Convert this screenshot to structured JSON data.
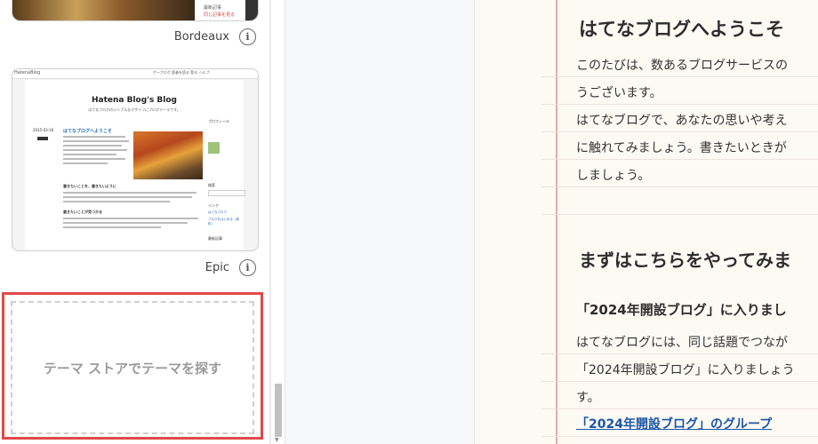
{
  "themes": {
    "top_partial": {
      "side_text_1": "最新記事",
      "side_text_2": "同じ記事を見る"
    },
    "bordeaux": {
      "label": "Bordeaux"
    },
    "epic": {
      "label": "Epic",
      "logo": "HatenaBlog",
      "nav": "ゲーブログ 読者を読る 登る ヘルプ",
      "blog_title": "Hatena Blog's Blog",
      "blog_subtitle": "はてなブログのシンプルなデザインにブログテーマです。",
      "date": "2015-03-16",
      "post_title": "はてなブログへようこそ",
      "h2_a": "書きたいことを、書きたいように",
      "h2_b": "書きたいことが見つかる",
      "side_profile": "プロフィール",
      "side_search": "検索",
      "side_links": "リンク",
      "side_recent": "最新記事",
      "side_link_1": "はてなブログ",
      "side_link_2": "ブログをはじめる（無料）"
    },
    "store_button": "テーマ ストアでテーマを探す"
  },
  "preview": {
    "heading": "はてなブログへようこそ",
    "lines": [
      "このたびは、数あるブログサービスの",
      "うございます。",
      "はてなブログで、あなたの思いや考え",
      "に触れてみましょう。書きたいときが",
      "しましょう。"
    ],
    "heading2": "まずはこちらをやってみま",
    "heading3": "「2024年開設ブログ」に入りまし",
    "lines2": [
      "はてなブログには、同じ話題でつなが",
      "「2024年開設ブログ」に入りましょう",
      "す。"
    ],
    "link": "「2024年開設ブログ」のグループ"
  }
}
